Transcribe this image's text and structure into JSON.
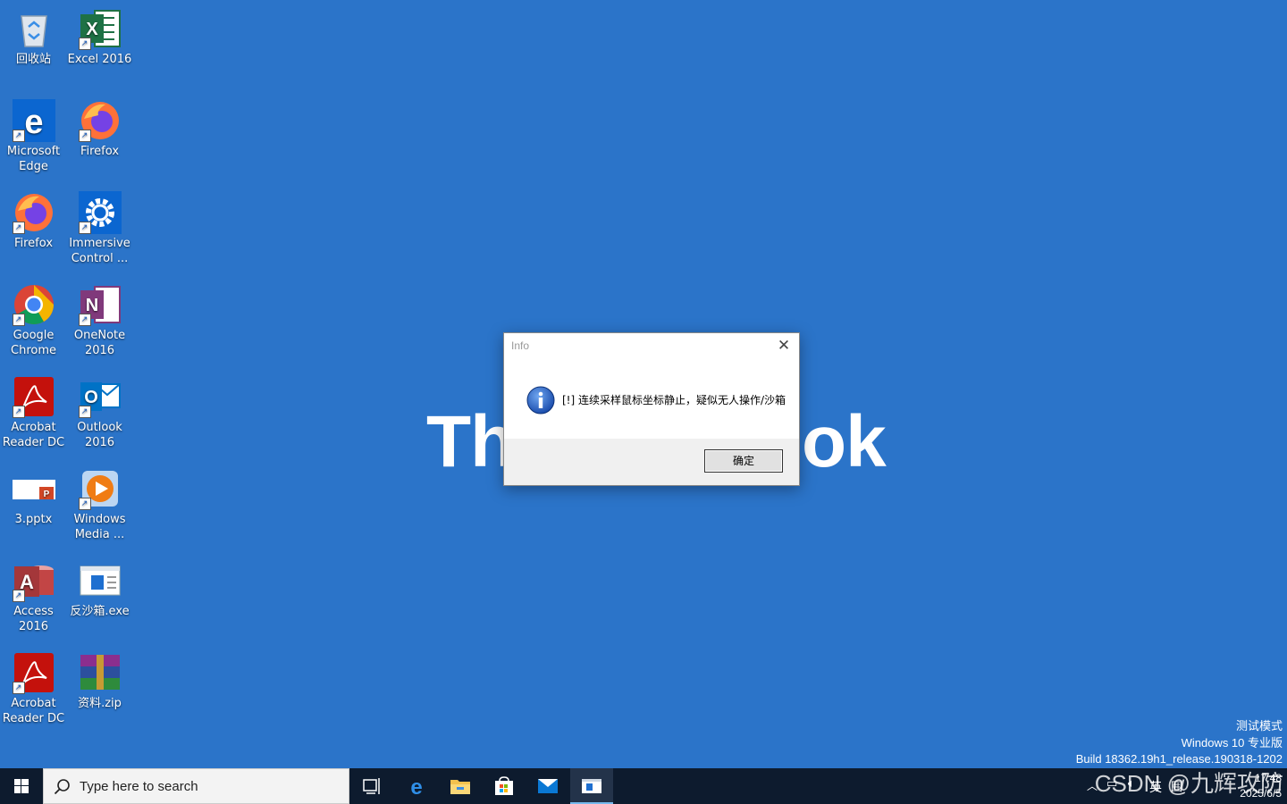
{
  "desktop": {
    "icons": [
      {
        "label": "回收站"
      },
      {
        "label": "Excel 2016"
      },
      {
        "label": "Microsoft Edge"
      },
      {
        "label": "Firefox"
      },
      {
        "label": "Firefox"
      },
      {
        "label": "Immersive Control ..."
      },
      {
        "label": "Google Chrome"
      },
      {
        "label": "OneNote 2016"
      },
      {
        "label": "Acrobat Reader DC"
      },
      {
        "label": "Outlook 2016"
      },
      {
        "label": "3.pptx"
      },
      {
        "label": "Windows Media ..."
      },
      {
        "label": "Access 2016"
      },
      {
        "label": "反沙箱.exe"
      },
      {
        "label": "Acrobat Reader DC"
      },
      {
        "label": "资料.zip"
      }
    ],
    "wallpaper_logo_left": "Th",
    "wallpaper_logo_right": "ok"
  },
  "watermark": {
    "line1": "测试模式",
    "line2": "Windows 10 专业版",
    "line3": "Build 18362.19h1_release.190318-1202"
  },
  "csdn_watermark": "CSDN @九辉攻防",
  "dialog": {
    "title": "Info",
    "message": "[!] 连续采样鼠标坐标静止，疑似无人操作/沙箱",
    "ok_label": "确定"
  },
  "taskbar": {
    "search_placeholder": "Type here to search",
    "time": "17:48",
    "date": "2025/6/5",
    "ime": "英"
  },
  "colors": {
    "desktop_bg": "#2b74c9",
    "taskbar_bg": "#0d1b2e",
    "accent": "#76b9ed"
  }
}
